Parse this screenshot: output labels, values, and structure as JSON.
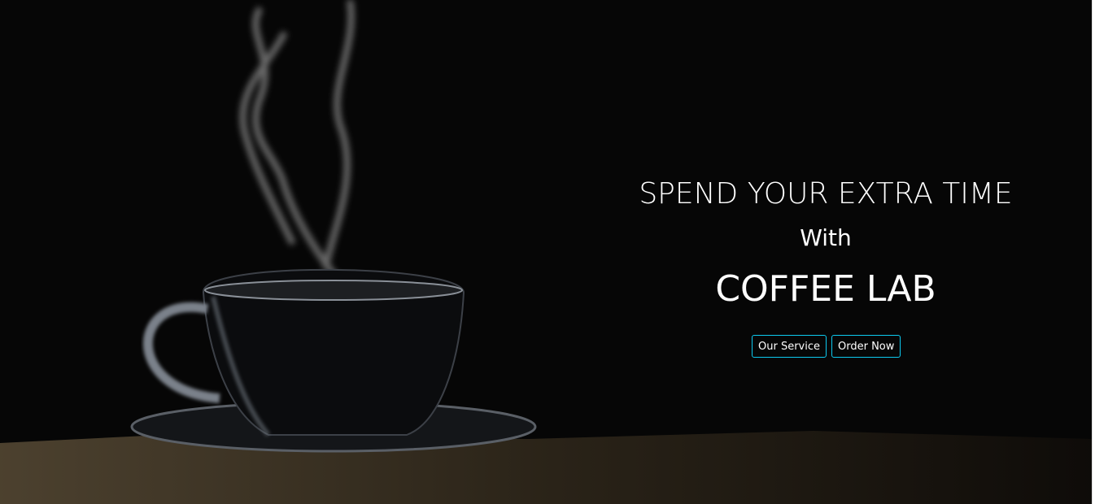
{
  "hero": {
    "headline": "SPEND YOUR EXTRA TIME",
    "connector": "With",
    "brand": "COFFEE LAB",
    "buttons": {
      "service": "Our Service",
      "order": "Order Now"
    },
    "accent_color": "#0dcaf0"
  }
}
